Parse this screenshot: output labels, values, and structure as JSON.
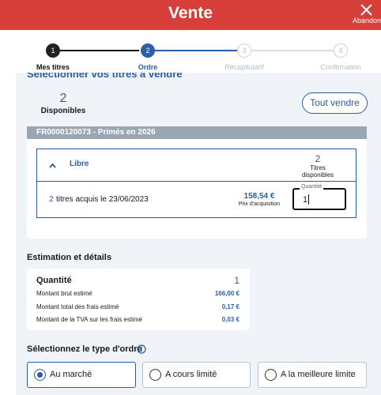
{
  "header": {
    "title": "Vente",
    "close_label": "Abandon"
  },
  "stepper": {
    "steps": [
      {
        "number": "1",
        "label": "Mes titres"
      },
      {
        "number": "2",
        "label": "Ordre"
      },
      {
        "number": "3",
        "label": "Récapitulatif"
      },
      {
        "number": "4",
        "label": "Confirmation"
      }
    ]
  },
  "selection": {
    "heading": "Sélectionner vos titres à vendre",
    "available_count": "2",
    "available_label": "Disponibles",
    "sell_all_label": "Tout vendre"
  },
  "security": {
    "title": "FR0000120073 - Primés en 2026",
    "group_label": "Libre",
    "group_count": "2",
    "group_count_label_1": "Titres",
    "group_count_label_2": "disponibles",
    "lot_count": "2",
    "lot_text": "titres acquis le 23/06/2023",
    "price": "158,54 €",
    "price_label": "Prix d'acquisition",
    "quantity_label": "Quantité",
    "quantity_value": "1"
  },
  "estimation": {
    "heading": "Estimation et détails",
    "quantity_label": "Quantité",
    "quantity_value": "1",
    "rows": [
      {
        "label": "Montant brut estimé",
        "value": "166,00 €"
      },
      {
        "label": "Montant total des frais estimé",
        "value": "0,17 €"
      },
      {
        "label": "Montant de la TVA sur les frais estimé",
        "value": "0,03 €"
      }
    ]
  },
  "order_type": {
    "heading": "Sélectionnez le type d'ordre",
    "info_icon": "info-icon",
    "options": [
      {
        "label": "Au marché",
        "selected": true
      },
      {
        "label": "A cours limité",
        "selected": false
      },
      {
        "label": "A la meilleure limite",
        "selected": false
      }
    ]
  },
  "colors": {
    "header": "#d63f3a",
    "accent": "#2a5ca8",
    "step_done": "#222222",
    "step_active": "#2d5ea8"
  }
}
